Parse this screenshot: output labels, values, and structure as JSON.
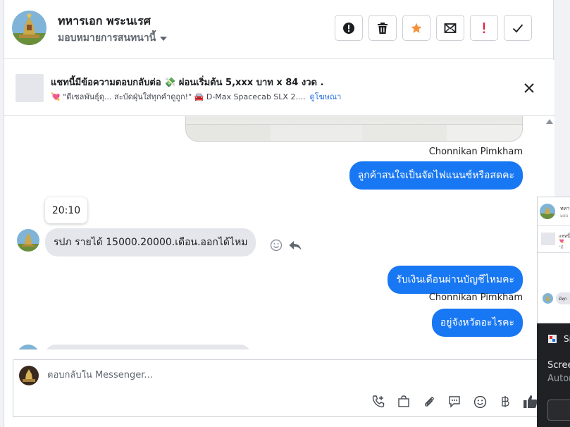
{
  "header": {
    "name": "ทหารเอก พระนเรศ",
    "assign_label": "มอบหมายการสนทนานี้",
    "tools": [
      {
        "icon": "alert-circle-icon"
      },
      {
        "icon": "trash-icon"
      },
      {
        "icon": "star-icon",
        "color": "#f7923a"
      },
      {
        "icon": "mail-unread-icon"
      },
      {
        "icon": "exclamation-icon",
        "color": "#e41e3f"
      },
      {
        "icon": "checkmark-icon"
      }
    ]
  },
  "ad": {
    "title": "แชทนี้มีข้อความตอบกลับต่อ 💸 ผ่อนเริ่มต้น 5,xxx บาท x 84 งวด .",
    "subtitle": "💘 \"ดีเซลพันธุ์ดุ... สะบัดฝุ่นใส่ทุกคำดูถูก!\" 🚘 D-Max Spacecab SLX 2....",
    "link": "ดูโฆษณา"
  },
  "messages": {
    "sender_1": "Chonnikan Pimkham",
    "out_1": "ลูกค้าสนใจเป็นจัดไฟแนนซ์หรือสดคะ",
    "time": "20:10",
    "in_1": "รปภ รายได้ 15000.20000.เดือน.ออกได้ไหม",
    "out_2": "รับเงินเดือนผ่านบัญชีไหมคะ",
    "sender_2": "Chonnikan Pimkham",
    "out_3": "อยู่จังหวัดอะไรคะ"
  },
  "composer": {
    "placeholder": "ตอบกลับใน Messenger..."
  },
  "overlay": {
    "mini_t1": "ทหาร",
    "mini_t2": "มอบ",
    "mini_ad1": "แชทนี้",
    "mini_ad2": "💘 \"ดี",
    "mini_bubble": "มีทุก",
    "dark_title": "Sr",
    "dark_line1": "Scree",
    "dark_line2": "Autor"
  },
  "colors": {
    "accent": "#1877f2",
    "incoming_bubble": "#e4e6eb",
    "link": "#216fdb",
    "star": "#f7923a",
    "alert": "#e41e3f"
  }
}
